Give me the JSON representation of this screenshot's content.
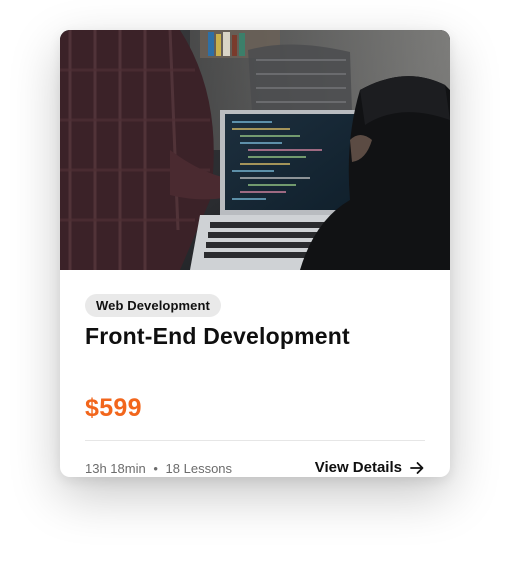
{
  "card": {
    "image_alt": "Developers looking at code on a laptop",
    "category": "Web Development",
    "title": "Front-End Development",
    "price": "$599",
    "duration": "13h 18min",
    "separator": "•",
    "lessons": "18 Lessons",
    "cta_label": "View Details",
    "cta_icon": "arrow-right-icon",
    "colors": {
      "price": "#f2661c",
      "badge_bg": "#e9e9e9",
      "divider": "#e6e6e6"
    }
  }
}
